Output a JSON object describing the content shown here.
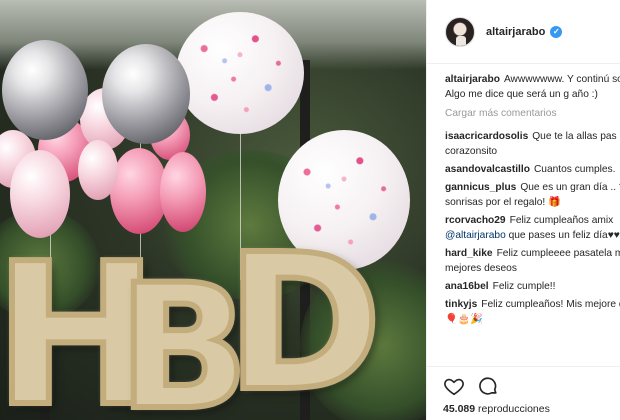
{
  "post": {
    "author": "altairjarabo",
    "verified_icon": "verified-check-icon",
    "accent_color": "#3897f0"
  },
  "media": {
    "balloon_letters": [
      "H",
      "B",
      "D"
    ]
  },
  "comments": {
    "caption": {
      "user": "altairjarabo",
      "text": "Awwwwwww. Y continú sonrisas. Algo me dice que será un g año :)"
    },
    "load_more_label": "Cargar más comentarios",
    "items": [
      {
        "user": "isaacricardosolis",
        "text": "Que te la allas pas maximo corazonsito"
      },
      {
        "user": "asandovalcastillo",
        "text": "Cuantos cumples."
      },
      {
        "user": "gannicus_plus",
        "text": "Que es un gran día .. ?.. Las sonrisas por el regalo! 🎁"
      },
      {
        "user": "rcorvacho29",
        "text": "Feliz cumpleaños amix",
        "mention": "@altairjarabo",
        "text_after": " que pases un feliz día♥♥♥♥♥♥♥"
      },
      {
        "user": "hard_kike",
        "text": "Feliz cumpleeee pasatela mis mejores deseos"
      },
      {
        "user": "ana16bel",
        "text": "Feliz cumple!!"
      },
      {
        "user": "tinkyjs",
        "text": "Feliz cumpleaños! Mis mejore deseos 🎈🎂🎉"
      }
    ]
  },
  "actions": {
    "like_icon": "heart-icon",
    "comment_icon": "comment-bubble-icon",
    "views_count": "45.089",
    "views_label": "reproducciones"
  }
}
